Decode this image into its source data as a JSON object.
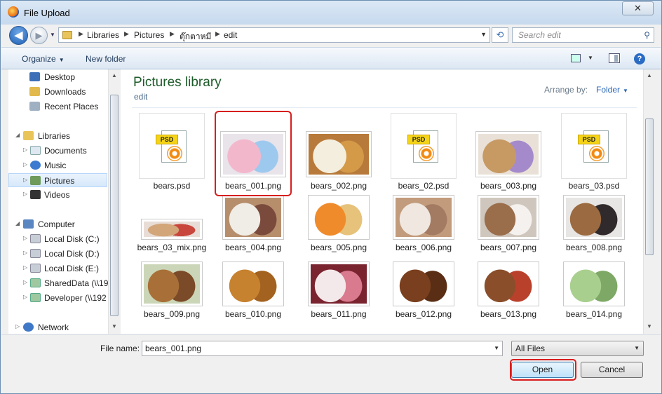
{
  "window": {
    "title": "File Upload",
    "close_glyph": "✕"
  },
  "nav": {
    "back_glyph": "◀",
    "forward_glyph": "▶",
    "breadcrumbs": [
      "Libraries",
      "Pictures",
      "ตุ๊กตาหมี",
      "edit"
    ],
    "search_placeholder": "Search edit"
  },
  "toolbar": {
    "organize": "Organize",
    "new_folder": "New folder",
    "help": "?"
  },
  "sidebar": {
    "items": [
      {
        "label": "Desktop",
        "icon": "desktop-icon"
      },
      {
        "label": "Downloads",
        "icon": "downloads-icon"
      },
      {
        "label": "Recent Places",
        "icon": "recent-places-icon"
      },
      {
        "label": "Libraries",
        "icon": "libraries-icon"
      },
      {
        "label": "Documents",
        "icon": "documents-icon"
      },
      {
        "label": "Music",
        "icon": "music-icon"
      },
      {
        "label": "Pictures",
        "icon": "pictures-icon"
      },
      {
        "label": "Videos",
        "icon": "videos-icon"
      },
      {
        "label": "Computer",
        "icon": "computer-icon"
      },
      {
        "label": "Local Disk (C:)",
        "icon": "disk-icon"
      },
      {
        "label": "Local Disk (D:)",
        "icon": "disk-icon"
      },
      {
        "label": "Local Disk (E:)",
        "icon": "disk-icon"
      },
      {
        "label": "SharedData (\\\\19",
        "icon": "network-drive-icon"
      },
      {
        "label": "Developer (\\\\192",
        "icon": "network-drive-icon"
      },
      {
        "label": "Network",
        "icon": "network-icon"
      }
    ]
  },
  "content": {
    "title": "Pictures library",
    "subtitle": "edit",
    "arrange_label": "Arrange by:",
    "arrange_value": "Folder",
    "files": [
      {
        "name": "bears.psd",
        "kind": "psd"
      },
      {
        "name": "bears_001.png",
        "kind": "image",
        "colors": [
          "#e9e3ea",
          "#f3b7cc",
          "#9ec9ee"
        ]
      },
      {
        "name": "bears_002.png",
        "kind": "image",
        "colors": [
          "#b87a3a",
          "#f4eede",
          "#d49a48"
        ]
      },
      {
        "name": "bears_02.psd",
        "kind": "psd"
      },
      {
        "name": "bears_003.png",
        "kind": "image",
        "colors": [
          "#e9e1d8",
          "#c79a63",
          "#a58acb"
        ]
      },
      {
        "name": "bears_03.psd",
        "kind": "psd"
      },
      {
        "name": "bears_03_mix.png",
        "kind": "image",
        "colors": [
          "#e8ddd6",
          "#d3a67a",
          "#c9463d"
        ]
      },
      {
        "name": "bears_004.png",
        "kind": "image",
        "colors": [
          "#b68e6c",
          "#f0ece6",
          "#7a4a3c"
        ]
      },
      {
        "name": "bears_005.png",
        "kind": "image",
        "colors": [
          "#ffffff",
          "#f08b2c",
          "#e6c27a"
        ]
      },
      {
        "name": "bears_006.png",
        "kind": "image",
        "colors": [
          "#c29b7c",
          "#efe7e0",
          "#a37a62"
        ]
      },
      {
        "name": "bears_007.png",
        "kind": "image",
        "colors": [
          "#cfc6bd",
          "#9a6d4b",
          "#f4f1ee"
        ]
      },
      {
        "name": "bears_008.png",
        "kind": "image",
        "colors": [
          "#e8e6e4",
          "#9b6a40",
          "#302a2c"
        ]
      },
      {
        "name": "bears_009.png",
        "kind": "image",
        "colors": [
          "#cbd6b8",
          "#a87038",
          "#7b4a28"
        ]
      },
      {
        "name": "bears_010.png",
        "kind": "image",
        "colors": [
          "#ffffff",
          "#c6822f",
          "#a3621f"
        ]
      },
      {
        "name": "bears_011.png",
        "kind": "image",
        "colors": [
          "#7a2430",
          "#f3e8ea",
          "#d97a8e"
        ]
      },
      {
        "name": "bears_012.png",
        "kind": "image",
        "colors": [
          "#ffffff",
          "#7a3f1e",
          "#5a2e14"
        ]
      },
      {
        "name": "bears_013.png",
        "kind": "image",
        "colors": [
          "#ffffff",
          "#8a4e2a",
          "#b9412c"
        ]
      },
      {
        "name": "bears_014.png",
        "kind": "image",
        "colors": [
          "#ffffff",
          "#a9cf8e",
          "#7ea866"
        ]
      }
    ]
  },
  "footer": {
    "file_name_label": "File name:",
    "file_name_value": "bears_001.png",
    "filter": "All Files",
    "open": "Open",
    "cancel": "Cancel"
  }
}
